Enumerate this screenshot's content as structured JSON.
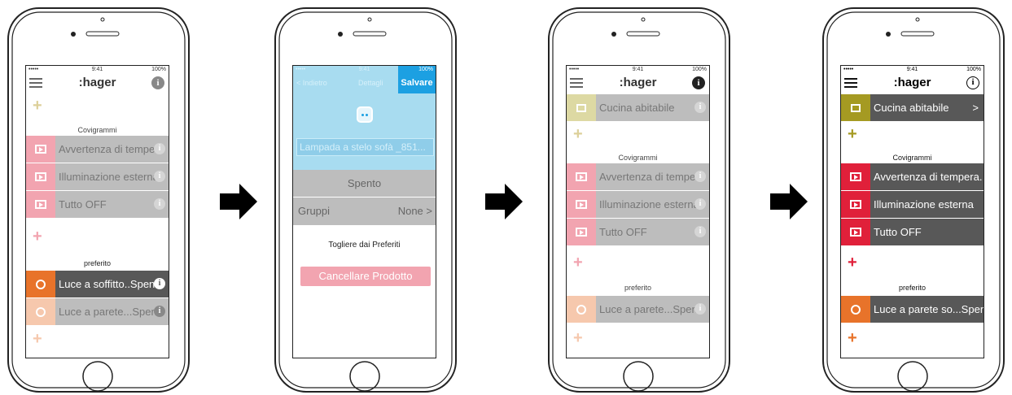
{
  "status": {
    "carrier": "•••••",
    "time": "9:41",
    "battery": "100%"
  },
  "app": {
    "logo": ":hager",
    "info": "i"
  },
  "colors": {
    "scene": "#e0203a",
    "scene_faded": "#f2a4b0",
    "room": "#a59a22",
    "room_faded": "#ddd9a3",
    "fav": "#e8732a",
    "fav_faded": "#f6c8ad",
    "selected_row": "#585858",
    "row": "#bdbdbd",
    "accent_blue": "#1ca0e2"
  },
  "icons": [
    "menu-icon",
    "info-icon",
    "plus-icon",
    "scene-icon",
    "room-icon",
    "device-icon",
    "arrow-right-icon",
    "chevron-right-icon"
  ],
  "screen1": {
    "plus_top": "+",
    "section_scenes": "Covigrammi",
    "scenes": [
      "Avvertenza di tempe.",
      "Illuminazione esterna",
      "Tutto OFF"
    ],
    "plus_mid": "+",
    "section_fav": "preferito",
    "favorites": [
      "Luce a soffitto..Spen.",
      "Luce a parete...Spen."
    ],
    "plus_bottom": "+"
  },
  "screen2": {
    "back": "< Indietro",
    "title": "Dettagli",
    "save": "Salvare",
    "name_value": "Lampada a stelo sofà _851...",
    "state": "Spento",
    "groups_label": "Gruppi",
    "groups_value": "None >",
    "remove_fav": "Togliere dai Preferiti",
    "delete_product": "Cancellare Prodotto"
  },
  "screen3": {
    "room": "Cucina abitabile",
    "plus_top": "+",
    "section_scenes": "Covigrammi",
    "scenes": [
      "Avvertenza di tempe.",
      "Illuminazione esterna",
      "Tutto OFF"
    ],
    "plus_mid": "+",
    "section_fav": "preferito",
    "favorites": [
      "Luce a parete...Spen."
    ],
    "plus_bottom": "+"
  },
  "screen4": {
    "room": "Cucina abitabile",
    "room_chevron": ">",
    "plus_top": "+",
    "section_scenes": "Covigrammi",
    "scenes": [
      "Avvertenza di tempera.",
      "Illuminazione esterna",
      "Tutto OFF"
    ],
    "plus_mid": "+",
    "section_fav": "preferito",
    "favorites": [
      "Luce a parete so...Spen."
    ],
    "plus_bottom": "+"
  }
}
